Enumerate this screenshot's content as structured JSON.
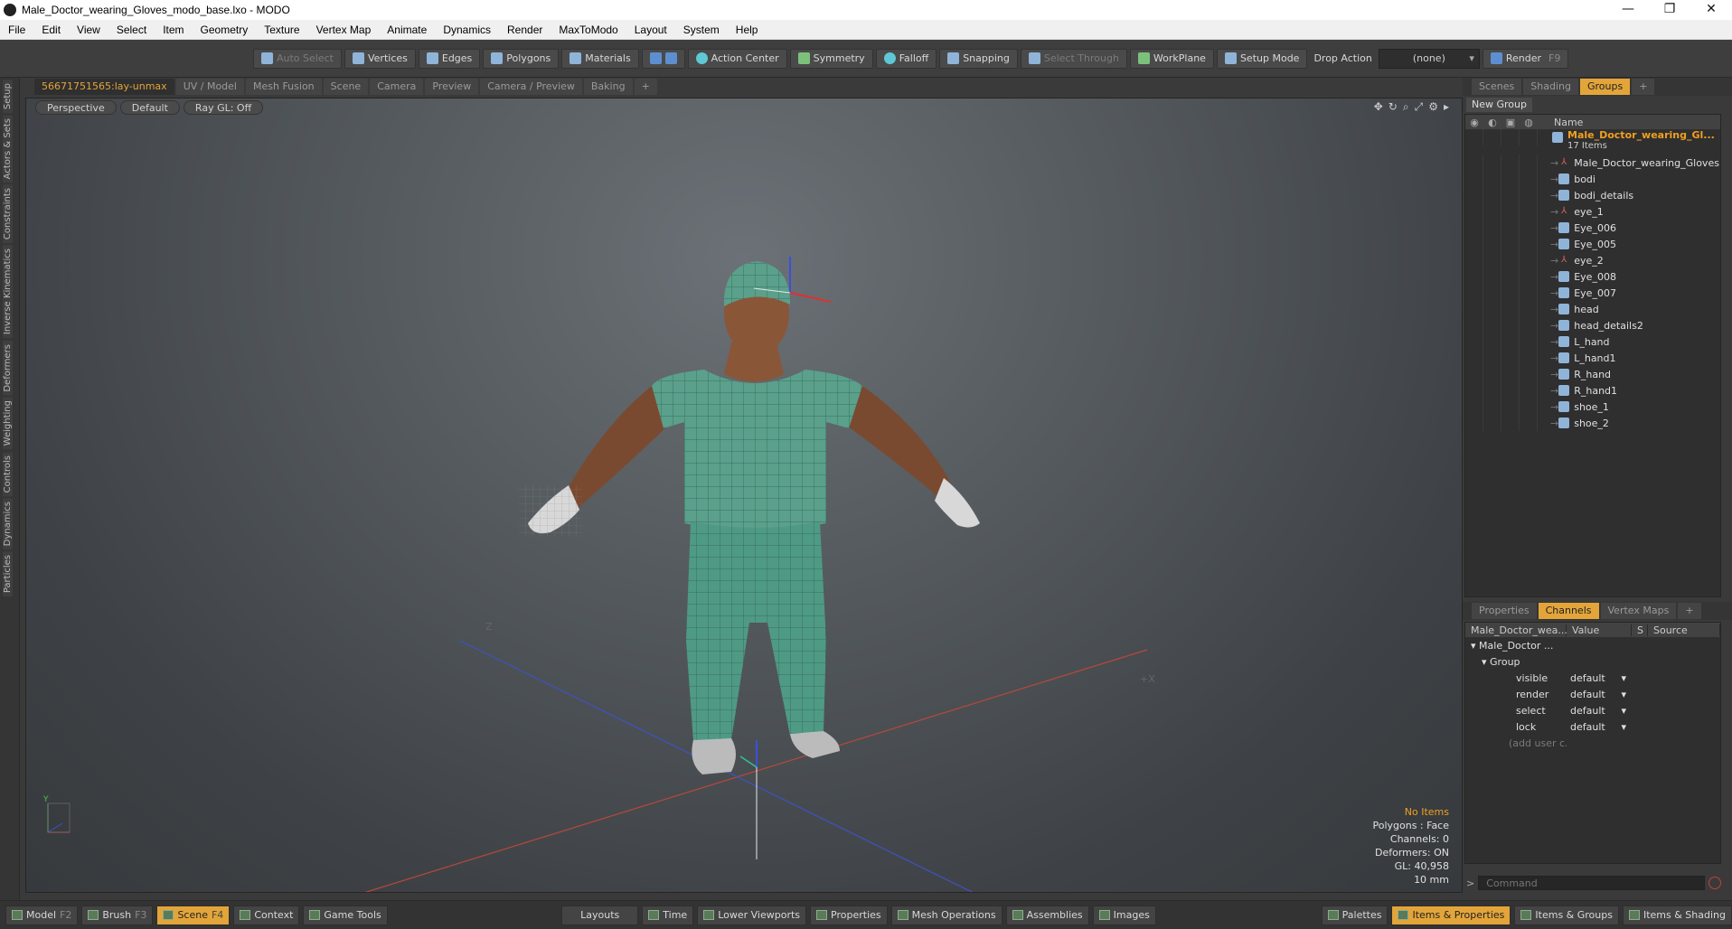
{
  "window": {
    "title": "Male_Doctor_wearing_Gloves_modo_base.lxo - MODO",
    "minimize": "—",
    "restore": "❐",
    "close": "✕"
  },
  "menu": [
    "File",
    "Edit",
    "View",
    "Select",
    "Item",
    "Geometry",
    "Texture",
    "Vertex Map",
    "Animate",
    "Dynamics",
    "Render",
    "MaxToModo",
    "Layout",
    "System",
    "Help"
  ],
  "toolbar": {
    "auto_select": "Auto Select",
    "vertices": "Vertices",
    "edges": "Edges",
    "polygons": "Polygons",
    "materials": "Materials",
    "action_center": "Action Center",
    "symmetry": "Symmetry",
    "falloff": "Falloff",
    "snapping": "Snapping",
    "select_through": "Select Through",
    "workplane": "WorkPlane",
    "setup_mode": "Setup Mode",
    "drop_action_label": "Drop Action",
    "drop_action_value": "(none)",
    "render": "Render",
    "render_key": "F9"
  },
  "left_tabs": [
    "Setup",
    "Actors & Sets",
    "Constraints",
    "Inverse Kinematics",
    "Deformers",
    "Weighting",
    "Controls",
    "Dynamics",
    "Particles"
  ],
  "viewport_tabs": [
    "56671751565:lay-unmax",
    "UV / Model",
    "Mesh Fusion",
    "Scene",
    "Camera",
    "Preview",
    "Camera / Preview",
    "Baking",
    "+"
  ],
  "viewport": {
    "perspective": "Perspective",
    "shading": "Default",
    "raygl": "Ray GL: Off",
    "info": {
      "no_items": "No Items",
      "polygons": "Polygons : Face",
      "channels": "Channels: 0",
      "deformers": "Deformers: ON",
      "gl": "GL: 40,958",
      "scale": "10 mm"
    },
    "axis_y": "Y",
    "axis_z": "Z",
    "axis_x": "+X"
  },
  "right_tabs_top": [
    "Scenes",
    "Shading",
    "Groups",
    "+"
  ],
  "groups": {
    "new_group": "New Group",
    "header_name": "Name",
    "root_name": "Male_Doctor_wearing_Gl...",
    "root_count": "17 Items",
    "items": [
      {
        "name": "Male_Doctor_wearing_Gloves",
        "kind": "locator"
      },
      {
        "name": "bodi",
        "kind": "mesh"
      },
      {
        "name": "bodi_details",
        "kind": "mesh"
      },
      {
        "name": "eye_1",
        "kind": "locator"
      },
      {
        "name": "Eye_006",
        "kind": "mesh"
      },
      {
        "name": "Eye_005",
        "kind": "mesh"
      },
      {
        "name": "eye_2",
        "kind": "locator"
      },
      {
        "name": "Eye_008",
        "kind": "mesh"
      },
      {
        "name": "Eye_007",
        "kind": "mesh"
      },
      {
        "name": "head",
        "kind": "mesh"
      },
      {
        "name": "head_details2",
        "kind": "mesh"
      },
      {
        "name": "L_hand",
        "kind": "mesh"
      },
      {
        "name": "L_hand1",
        "kind": "mesh"
      },
      {
        "name": "R_hand",
        "kind": "mesh"
      },
      {
        "name": "R_hand1",
        "kind": "mesh"
      },
      {
        "name": "shoe_1",
        "kind": "mesh"
      },
      {
        "name": "shoe_2",
        "kind": "mesh"
      }
    ]
  },
  "right_tabs_bottom": [
    "Properties",
    "Channels",
    "Vertex Maps",
    "+"
  ],
  "channels": {
    "header_item": "Male_Doctor_wea...",
    "header_value": "Value",
    "header_s": "S",
    "header_source": "Source",
    "root": "Male_Doctor ...",
    "group": "Group",
    "rows": [
      {
        "name": "visible",
        "value": "default"
      },
      {
        "name": "render",
        "value": "default"
      },
      {
        "name": "select",
        "value": "default"
      },
      {
        "name": "lock",
        "value": "default"
      }
    ],
    "add_user": "(add user c..."
  },
  "command_placeholder": "Command",
  "bottom": {
    "model": "Model",
    "model_key": "F2",
    "brush": "Brush",
    "brush_key": "F3",
    "scene": "Scene",
    "scene_key": "F4",
    "context": "Context",
    "game_tools": "Game Tools",
    "layouts": "Layouts",
    "time": "Time",
    "lower_viewports": "Lower Viewports",
    "properties": "Properties",
    "mesh_operations": "Mesh Operations",
    "assemblies": "Assemblies",
    "images": "Images",
    "palettes": "Palettes",
    "items_properties": "Items & Properties",
    "items_groups": "Items & Groups",
    "items_shading": "Items & Shading"
  },
  "colors": {
    "accent": "#e3a53a",
    "viewport_bg": "#565b5f",
    "scrubs": "#4f9a85"
  }
}
